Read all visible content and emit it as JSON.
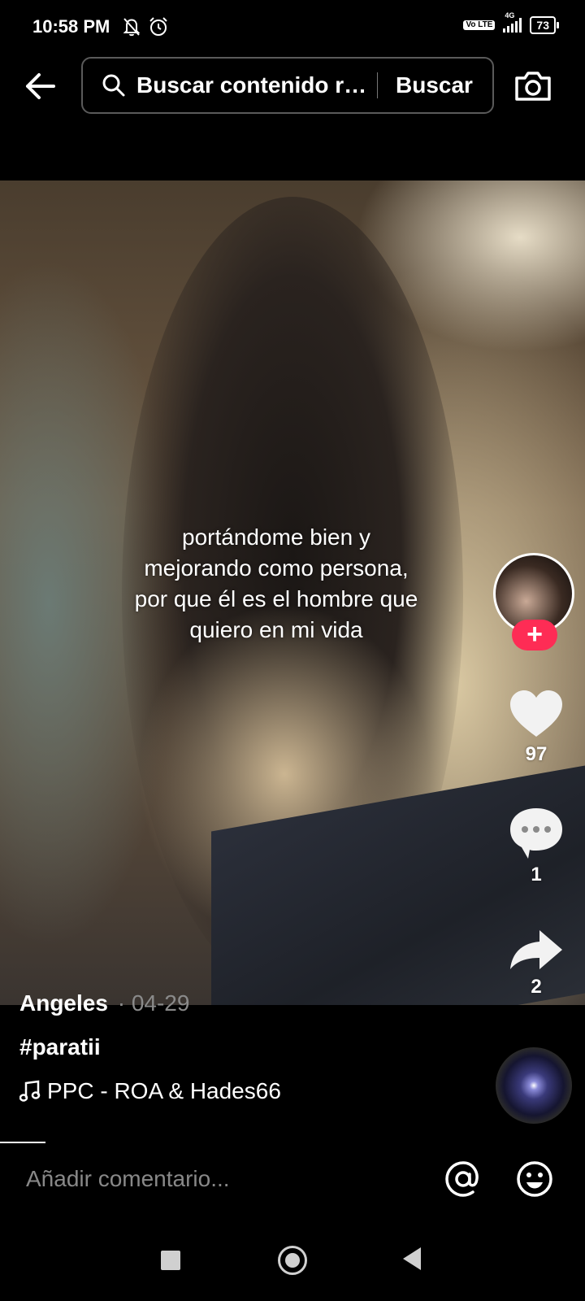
{
  "status_bar": {
    "time": "10:58 PM",
    "network_badge": "Vo LTE",
    "network_type": "4G",
    "battery": "73",
    "icons": [
      "bell-off-icon",
      "alarm-icon",
      "volte-icon",
      "signal-icon",
      "battery-icon"
    ]
  },
  "header": {
    "search_value": "Buscar contenido r…",
    "search_button": "Buscar",
    "icons": [
      "back-arrow-icon",
      "search-icon",
      "camera-icon"
    ]
  },
  "video": {
    "caption_lines": [
      "portándome bien y",
      "mejorando como persona,",
      "por que él es el hombre que",
      "quiero en mi vida"
    ]
  },
  "actions": {
    "follow_label": "+",
    "likes": "97",
    "comments": "1",
    "shares": "2",
    "accent_color": "#fe2c55"
  },
  "info": {
    "author": "Angeles",
    "date": "· 04-29",
    "hashtags": "#paratii",
    "music": "PPC - ROA & Hades66"
  },
  "comment_bar": {
    "placeholder": "Añadir comentario...",
    "icons": [
      "at-mention-icon",
      "emoji-icon"
    ]
  }
}
